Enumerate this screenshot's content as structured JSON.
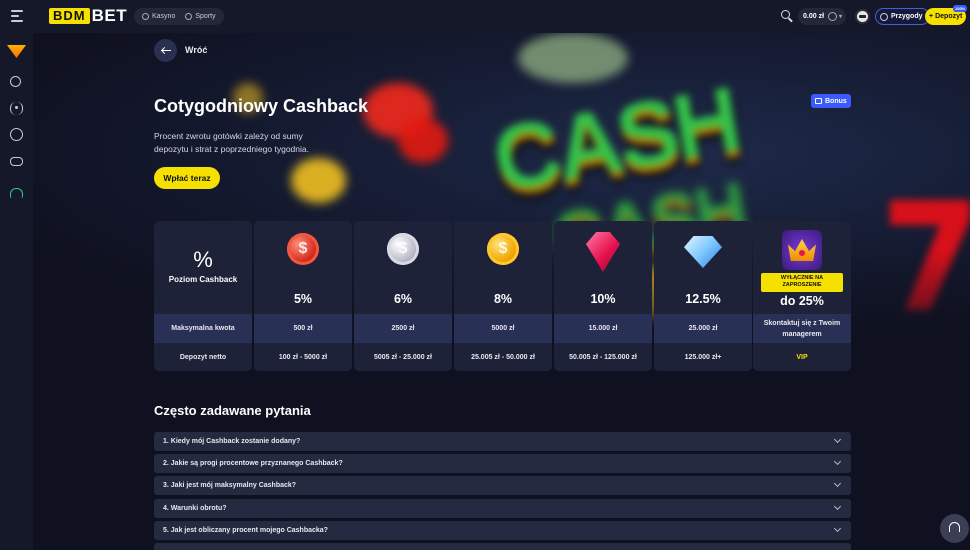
{
  "header": {
    "logo_left": "BDM",
    "logo_right": "BET",
    "nav": [
      {
        "label": "Kasyno",
        "icon": "casino-icon"
      },
      {
        "label": "Sporty",
        "icon": "sports-icon"
      }
    ],
    "balance": "0.00 zł",
    "friends_label": "Przygody",
    "deposit_label": "Depozyt",
    "deposit_badge": "100%"
  },
  "sidebar": {
    "items": [
      "promo-icon",
      "slots-icon",
      "live-icon",
      "soccer-icon",
      "gamepad-icon",
      "support-icon"
    ]
  },
  "page": {
    "back_label": "Wróć",
    "title": "Cotygodniowy Cashback",
    "description": "Procent zwrotu gotówki zależy od sumy depozytu i strat z poprzedniego tygodnia.",
    "cta_label": "Wpłać teraz",
    "bonus_tag": "Bonus"
  },
  "cashback_table": {
    "header_symbol": "%",
    "header_label": "Poziom Cashback",
    "row_labels": [
      "Maksymalna kwota",
      "Depozyt netto"
    ],
    "tiers": [
      {
        "percent": "5%",
        "max": "500 zł",
        "deposit": "100 zł - 5000 zł",
        "icon": "red-coin-icon"
      },
      {
        "percent": "6%",
        "max": "2500 zł",
        "deposit": "5005 zł - 25.000 zł",
        "icon": "silver-coin-icon"
      },
      {
        "percent": "8%",
        "max": "5000 zł",
        "deposit": "25.005 zł - 50.000 zł",
        "icon": "gold-coin-icon"
      },
      {
        "percent": "10%",
        "max": "15.000 zł",
        "deposit": "50.005 zł - 125.000 zł",
        "icon": "ruby-icon"
      },
      {
        "percent": "12.5%",
        "max": "25.000 zł",
        "deposit": "125.000 zł+",
        "icon": "diamond-icon"
      }
    ],
    "vip": {
      "badge": "WYŁĄCZNIE NA ZAPROSZENIE",
      "percent": "do 25%",
      "contact": "Skontaktuj się z Twoim managerem",
      "label": "VIP",
      "icon": "crown-icon"
    }
  },
  "faq": {
    "title": "Często zadawane pytania",
    "items": [
      "1.  Kiedy mój Cashback zostanie dodany?",
      "2.  Jakie są progi procentowe przyznanego Cashback?",
      "3.  Jaki jest mój maksymalny Cashback?",
      "4.  Warunki obrotu?",
      "5.  Jak jest obliczany procent mojego Cashbacka?"
    ]
  },
  "colors": {
    "accent_yellow": "#f5e000",
    "accent_blue": "#3b5bff",
    "background": "#0f1120",
    "panel": "#1d2238"
  }
}
